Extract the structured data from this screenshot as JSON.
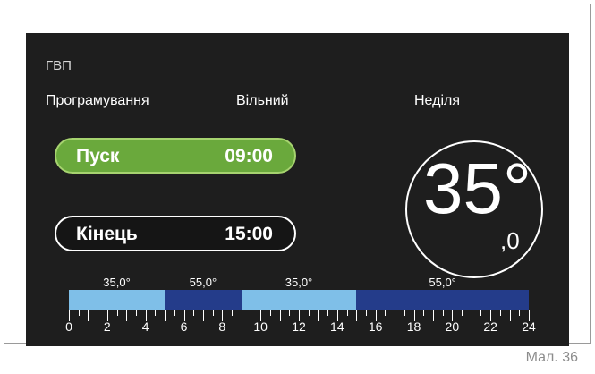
{
  "screen": {
    "title": "ГВП",
    "headers": {
      "mode": "Програмування",
      "status": "Вільний",
      "day": "Неділя"
    },
    "start": {
      "label": "Пуск",
      "time": "09:00"
    },
    "end": {
      "label": "Кінець",
      "time": "15:00"
    },
    "temperature": {
      "integer": "35°",
      "decimal": ",0"
    },
    "schedule": [
      {
        "from": 0,
        "to": 5,
        "temp": "35,0°",
        "color": "#7fbfe8"
      },
      {
        "from": 5,
        "to": 9,
        "temp": "55,0°",
        "color": "#243c8a"
      },
      {
        "from": 9,
        "to": 15,
        "temp": "35,0°",
        "color": "#7fbfe8"
      },
      {
        "from": 15,
        "to": 24,
        "temp": "55,0°",
        "color": "#243c8a"
      }
    ],
    "hours": [
      "0",
      "2",
      "4",
      "6",
      "8",
      "10",
      "12",
      "14",
      "16",
      "18",
      "20",
      "22",
      "24"
    ]
  },
  "caption": "Мал. 36"
}
